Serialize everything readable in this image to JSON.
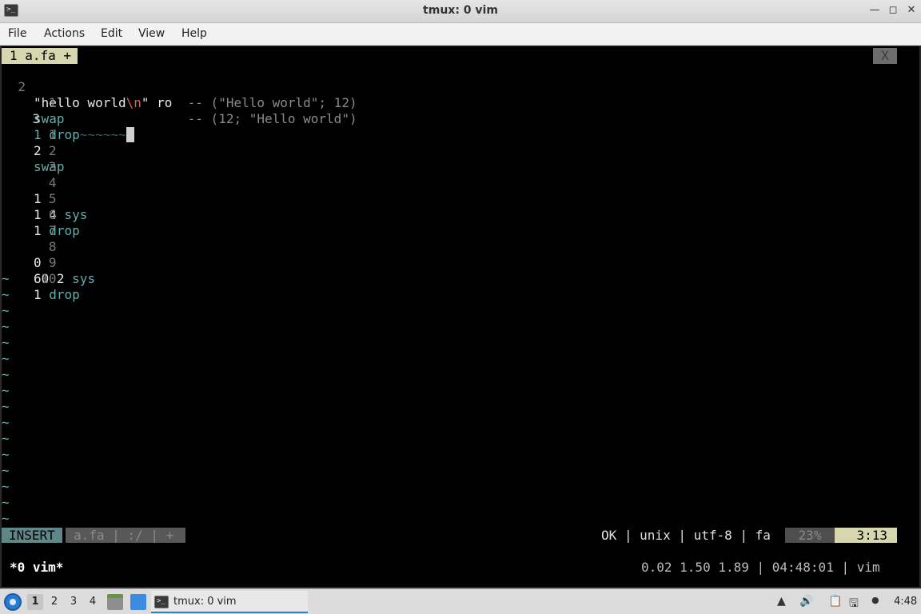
{
  "window": {
    "title": "tmux: 0 vim",
    "app_icon": "terminal-icon",
    "controls": [
      "minimize-icon",
      "maximize-icon",
      "close-icon"
    ]
  },
  "menu": [
    "File",
    "Actions",
    "Edit",
    "View",
    "Help"
  ],
  "vim": {
    "tab_label": "1 a.fa +",
    "tab_close": "X",
    "lines": [
      {
        "num": "2",
        "code": "\"hello world",
        "nl": "\\n",
        "rest": "\" ro",
        "comment": "  -- (\"Hello world\"; 12)"
      },
      {
        "num": "1",
        "code": "swap",
        "comment": "                -- (12; \"Hello world\")"
      },
      {
        "num": "3",
        "code": "1 drop",
        "trail": "~~~~~~"
      },
      {
        "num": "1",
        "code": "2"
      },
      {
        "num": "2",
        "code": "swap"
      },
      {
        "num": "3",
        "code": ""
      },
      {
        "num": "4",
        "code": "1"
      },
      {
        "num": "5",
        "code": "1 4 sys"
      },
      {
        "num": "6",
        "code": "1 drop"
      },
      {
        "num": "7",
        "code": ""
      },
      {
        "num": "8",
        "code": "0"
      },
      {
        "num": "9",
        "code": "60 2 sys"
      },
      {
        "num": "10",
        "code": "1 drop"
      }
    ],
    "tilde_count": 16,
    "tilde": "~",
    "status": {
      "mode": "INSERT",
      "file_segment": "a.fa | :/ | +",
      "info": "OK | unix | utf-8 | fa",
      "percent": "23%",
      "position": "3:13"
    }
  },
  "tmux": {
    "window_label": "*0 vim*",
    "right": "0.02 1.50 1.89 | 04:48:01 | vim"
  },
  "taskbar": {
    "workspaces": [
      "1",
      "2",
      "3",
      "4"
    ],
    "active_workspace": "1",
    "task_label": "tmux: 0 vim",
    "clock": "4:48",
    "tray_icons": [
      "scroll-icon",
      "volume-icon",
      "clipboard-icon",
      "network-icon"
    ]
  },
  "colors": {
    "accent": "#2f7fd4",
    "insert_bg": "#5f8787",
    "tab_bg": "#d7d7af"
  }
}
